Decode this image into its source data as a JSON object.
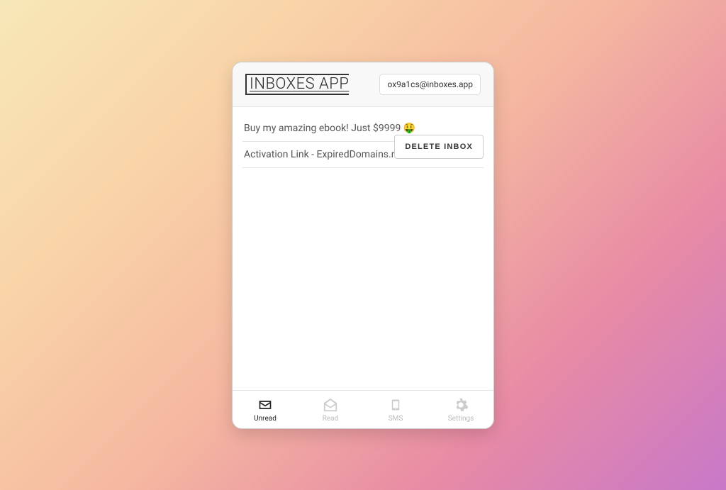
{
  "header": {
    "logo_text": "INBOXES APP",
    "email_address": "ox9a1cs@inboxes.app"
  },
  "messages": [
    {
      "subject": "Buy my amazing ebook! Just $9999 🤑"
    },
    {
      "subject": "Activation Link - ExpiredDomains.net"
    }
  ],
  "actions": {
    "delete_inbox_label": "DELETE INBOX"
  },
  "tabs": {
    "unread": "Unread",
    "read": "Read",
    "sms": "SMS",
    "settings": "Settings"
  }
}
